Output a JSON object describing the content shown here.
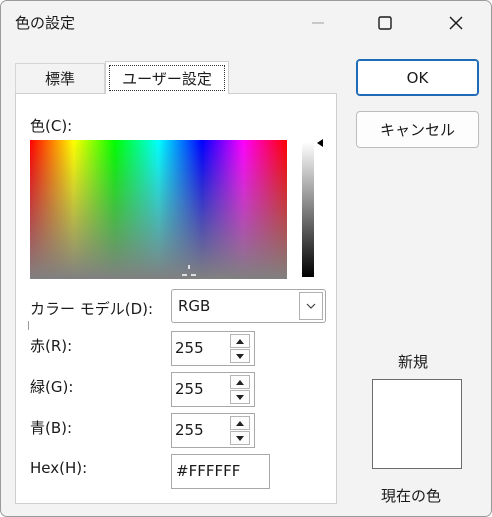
{
  "window": {
    "title": "色の設定"
  },
  "tabs": [
    {
      "label": "標準",
      "selected": false
    },
    {
      "label": "ユーザー設定",
      "selected": true
    }
  ],
  "custom": {
    "color_label": "色(C):",
    "color_model_label": "カラー モデル(D):",
    "color_model_value": "RGB",
    "red_label": "赤(R):",
    "red_value": "255",
    "green_label": "緑(G):",
    "green_value": "255",
    "blue_label": "青(B):",
    "blue_value": "255",
    "hex_label": "Hex(H):",
    "hex_value": "#FFFFFF",
    "luminance_level": 1.0
  },
  "buttons": {
    "ok": "OK",
    "cancel": "キャンセル"
  },
  "preview": {
    "new_label": "新規",
    "current_label": "現在の色",
    "color": "#FFFFFF"
  },
  "colors": {
    "accent": "#1D6AB6"
  }
}
